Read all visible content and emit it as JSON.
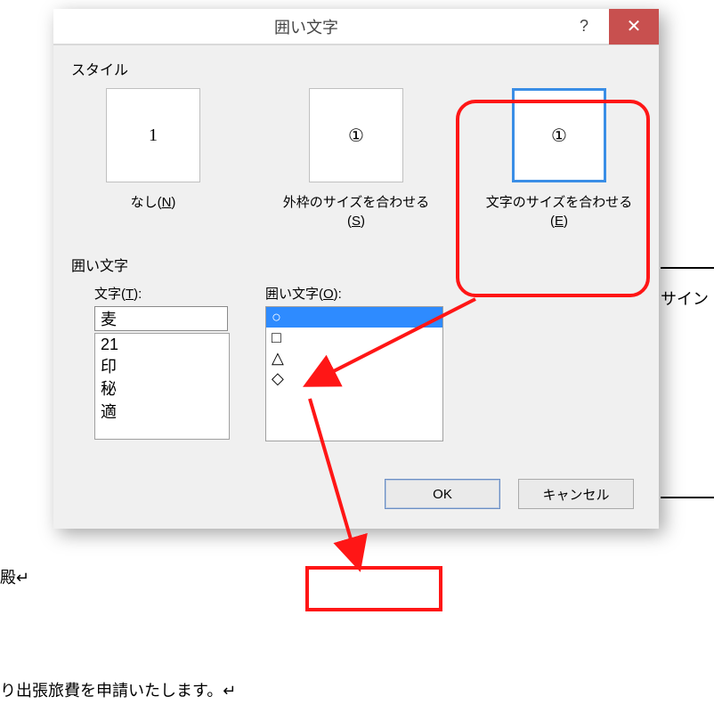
{
  "background": {
    "text1": "殿↵",
    "text2": "り出張旅費を申請いたします。↵",
    "sign": "サイン"
  },
  "dialog": {
    "title": "囲い文字",
    "help": "?",
    "close": "✕",
    "styleLabel": "スタイル",
    "styles": [
      {
        "preview": "1",
        "caption_pre": "なし(",
        "mnemonic": "N",
        "caption_post": ")"
      },
      {
        "preview": "①",
        "caption_pre": "外枠のサイズを合わせる(",
        "mnemonic": "S",
        "caption_post": ")"
      },
      {
        "preview": "①",
        "caption_pre": "文字のサイズを合わせる(",
        "mnemonic": "E",
        "caption_post": ")"
      }
    ],
    "sectionLabel": "囲い文字",
    "charLabelPre": "文字(",
    "charMnemonic": "T",
    "charLabelPost": "):",
    "charValue": "麦",
    "charList": [
      "21",
      "印",
      "秘",
      "適"
    ],
    "encLabelPre": "囲い文字(",
    "encMnemonic": "O",
    "encLabelPost": "):",
    "encList": [
      "○",
      "□",
      "△",
      "◇"
    ],
    "buttons": {
      "ok": "OK",
      "cancel": "キャンセル"
    }
  }
}
